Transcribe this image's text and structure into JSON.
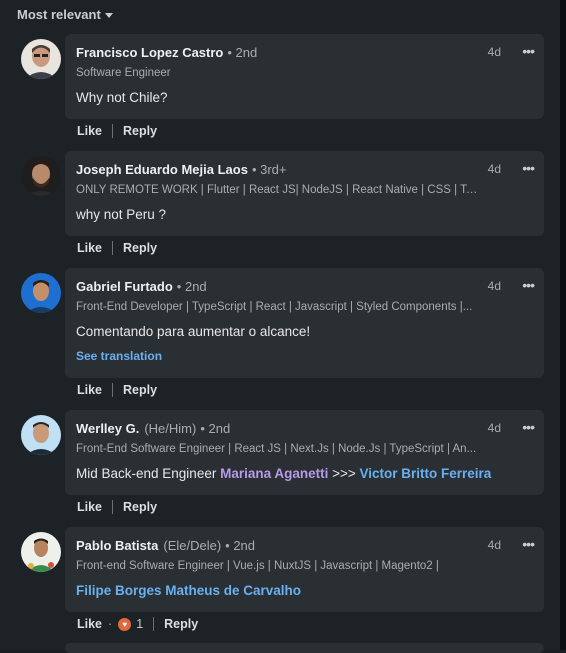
{
  "sort": {
    "label": "Most relevant"
  },
  "comments": [
    {
      "name": "Francisco Lopez Castro",
      "pronouns": "",
      "degree": "• 2nd",
      "headline": "Software Engineer",
      "time": "4d",
      "text_plain": "Why not Chile?",
      "like_label": "Like",
      "reply_label": "Reply"
    },
    {
      "name": "Joseph Eduardo Mejia Laos",
      "pronouns": "",
      "degree": "• 3rd+",
      "headline": "ONLY REMOTE WORK | Flutter | React JS| NodeJS | React Native | CSS | Tail...",
      "time": "4d",
      "text_plain": "why not Peru ?",
      "like_label": "Like",
      "reply_label": "Reply"
    },
    {
      "name": "Gabriel Furtado",
      "pronouns": "",
      "degree": "• 2nd",
      "headline": "Front-End Developer | TypeScript | React | Javascript | Styled Components |...",
      "time": "4d",
      "text_plain": "Comentando para aumentar o alcance!",
      "see_translation": "See translation",
      "like_label": "Like",
      "reply_label": "Reply"
    },
    {
      "name": "Werlley G.",
      "pronouns": "(He/Him)",
      "degree": "• 2nd",
      "headline": "Front-End Software Engineer | React JS | Next.Js | Node.Js | TypeScript | An...",
      "time": "4d",
      "text_prefix": "Mid Back-end Engineer ",
      "mention_1": "Mariana Aganetti",
      "text_middle": " >>> ",
      "mention_2": "Victor Britto Ferreira",
      "like_label": "Like",
      "reply_label": "Reply"
    },
    {
      "name": "Pablo Batista",
      "pronouns": "(Ele/Dele)",
      "degree": "• 2nd",
      "headline": "Front-end Software Engineer | Vue.js | NuxtJS | Javascript | Magento2 |",
      "time": "4d",
      "mention_1": "Filipe Borges Matheus de Carvalho",
      "like_label": "Like",
      "dot": "·",
      "reaction_count": "1",
      "reply_label": "Reply"
    }
  ],
  "colors": {
    "background": "#1d2226",
    "bubble": "#2a2f34",
    "mention_blue": "#6ab0f0",
    "mention_violet": "#b79ae8",
    "reaction": "#e06a3e"
  },
  "icons": {
    "sort": "caret-down-icon",
    "more": "more-horizontal-icon",
    "reaction": "heart-reaction-icon"
  }
}
